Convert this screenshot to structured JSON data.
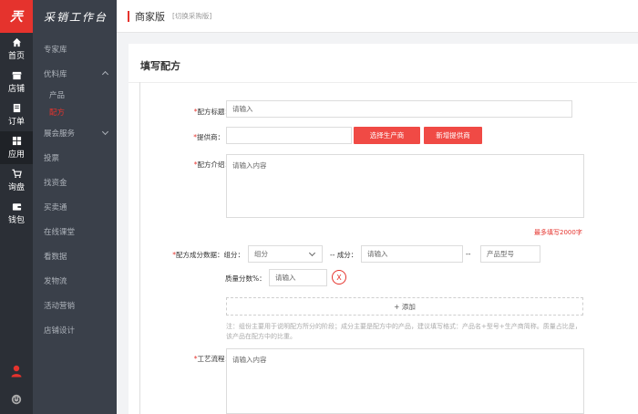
{
  "rail": {
    "logo": "兲",
    "items": [
      {
        "label": "首页",
        "icon": "home-icon"
      },
      {
        "label": "店铺",
        "icon": "store-icon"
      },
      {
        "label": "订单",
        "icon": "order-icon"
      },
      {
        "label": "应用",
        "icon": "apps-icon"
      },
      {
        "label": "询盘",
        "icon": "cart-icon"
      },
      {
        "label": "钱包",
        "icon": "wallet-icon"
      }
    ]
  },
  "sidebar": {
    "brand": "采销工作台",
    "items": [
      {
        "label": "专家库"
      },
      {
        "label": "优料库"
      },
      {
        "label": "产品"
      },
      {
        "label": "配方"
      },
      {
        "label": "展会服务"
      },
      {
        "label": "投票"
      },
      {
        "label": "找资金"
      },
      {
        "label": "买卖通"
      },
      {
        "label": "在线课堂"
      },
      {
        "label": "看数据"
      },
      {
        "label": "发物流"
      },
      {
        "label": "活动营销"
      },
      {
        "label": "店铺设计"
      }
    ]
  },
  "topbar": {
    "title": "商家版",
    "switch": "[切换采购版]"
  },
  "page": {
    "title": "填写配方"
  },
  "form": {
    "req": "*",
    "title_label": "配方标题：",
    "title_placeholder": "请输入",
    "supplier_label": "提供商：",
    "select_supplier": "选择生产商",
    "add_supplier": "新增提供商",
    "intro_label": "配方介绍：",
    "intro_placeholder": "请输入内容",
    "intro_limit": "最多填写2000字",
    "composition_label": "配方成分数据：",
    "group_label": "组分：",
    "group_value": "组分",
    "sep1": "--",
    "ingredient_label": "成分：",
    "ingredient_placeholder": "请输入",
    "sep2": "--",
    "model_placeholder": "产品型号",
    "mass_label": "质量分数%：",
    "mass_placeholder": "请输入",
    "delete_label": "X",
    "add_label": "+ 添加",
    "note": "注：组份主要用于说明配方所分的阶段；成分主要是配方中的产品，建议填写格式：产品名+型号+生产商简称。质量占比是，该产品在配方中的比重。",
    "process_label": "工艺流程：",
    "process_placeholder": "请输入内容"
  }
}
